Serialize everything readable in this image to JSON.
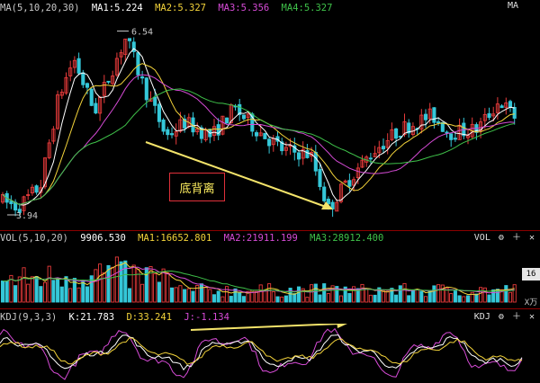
{
  "main_header": {
    "label": "MA(5,10,20,30)",
    "ma1": "MA1:5.224",
    "ma2": "MA2:5.327",
    "ma3": "MA3:5.356",
    "ma4": "MA4:5.327",
    "right": "MA"
  },
  "vol_header": {
    "label": "VOL(5,10,20)",
    "value": "9906.530",
    "ma1": "MA1:16652.801",
    "ma2": "MA2:21911.199",
    "ma3": "MA3:28912.400",
    "right": "VOL"
  },
  "kdj_header": {
    "label": "KDJ(9,3,3)",
    "k": "K:21.783",
    "d": "D:33.241",
    "j": "J:-1.134",
    "right": "KDJ"
  },
  "annotations": {
    "high": "6.54",
    "low": "3.94",
    "divergence": "底背离"
  },
  "vol_axis": {
    "value": "16",
    "unit": "X万"
  },
  "colors": {
    "up": "#e83b3b",
    "down": "#35c7d8",
    "ma1": "#ffffff",
    "ma2": "#f3d33a",
    "ma3": "#d64bd6",
    "ma4": "#3fc24a",
    "divergence_line": "#f3e36a"
  },
  "chart_data": [
    {
      "type": "candlestick",
      "title": "MA(5,10,20,30)",
      "ylim": [
        3.8,
        6.7
      ],
      "high_marker": 6.54,
      "low_marker": 3.94,
      "series": [
        {
          "name": "MA1",
          "last": 5.224
        },
        {
          "name": "MA2",
          "last": 5.327
        },
        {
          "name": "MA3",
          "last": 5.356
        },
        {
          "name": "MA4",
          "last": 5.327
        }
      ]
    },
    {
      "type": "bar",
      "title": "VOL(5,10,20)",
      "last": 9906.53,
      "series": [
        {
          "name": "MA1",
          "last": 16652.801
        },
        {
          "name": "MA2",
          "last": 21911.199
        },
        {
          "name": "MA3",
          "last": 28912.4
        }
      ]
    },
    {
      "type": "line",
      "title": "KDJ(9,3,3)",
      "series": [
        {
          "name": "K",
          "last": 21.783
        },
        {
          "name": "D",
          "last": 33.241
        },
        {
          "name": "J",
          "last": -1.134
        }
      ]
    }
  ]
}
